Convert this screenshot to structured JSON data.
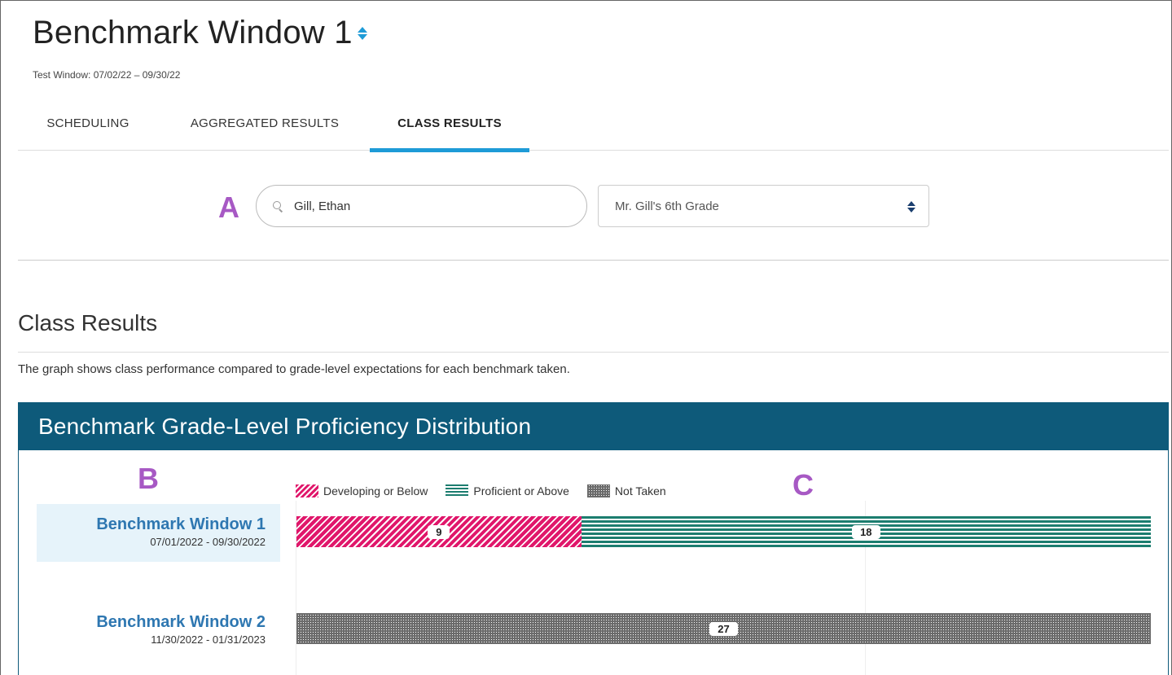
{
  "header": {
    "title": "Benchmark Window 1",
    "subtitle": "Test Window: 07/02/22 – 09/30/22"
  },
  "tabs": [
    {
      "label": "SCHEDULING",
      "active": false
    },
    {
      "label": "AGGREGATED RESULTS",
      "active": false
    },
    {
      "label": "CLASS RESULTS",
      "active": true
    }
  ],
  "callouts": {
    "a": "A",
    "b": "B",
    "c": "C"
  },
  "filters": {
    "search_value": "Gill, Ethan",
    "class_select": "Mr. Gill's 6th Grade"
  },
  "section": {
    "title": "Class Results",
    "description": "The graph shows class performance compared to grade-level expectations for each benchmark taken."
  },
  "chart_panel": {
    "title": "Benchmark Grade-Level Proficiency Distribution"
  },
  "colors": {
    "accent": "#1e9bd7",
    "header_bg": "#0e5a7a",
    "developing": "#e0176b",
    "proficient": "#1c7d6f",
    "not_taken": "#6b6b6b",
    "link": "#2e77b1",
    "callout": "#a759c4"
  },
  "chart_data": {
    "type": "bar",
    "orientation": "horizontal",
    "stacked": true,
    "title": "Benchmark Grade-Level Proficiency Distribution",
    "legend": [
      "Developing or Below",
      "Proficient or Above",
      "Not Taken"
    ],
    "legend_placement": "top",
    "categories": [
      {
        "name": "Benchmark Window 1",
        "dates": "07/01/2022 - 09/30/2022",
        "selected": true
      },
      {
        "name": "Benchmark Window 2",
        "dates": "11/30/2022 - 01/31/2023",
        "selected": false
      }
    ],
    "series": [
      {
        "name": "Developing or Below",
        "values": [
          9,
          0
        ]
      },
      {
        "name": "Proficient or Above",
        "values": [
          18,
          0
        ]
      },
      {
        "name": "Not Taken",
        "values": [
          0,
          27
        ]
      }
    ],
    "total": 27
  }
}
